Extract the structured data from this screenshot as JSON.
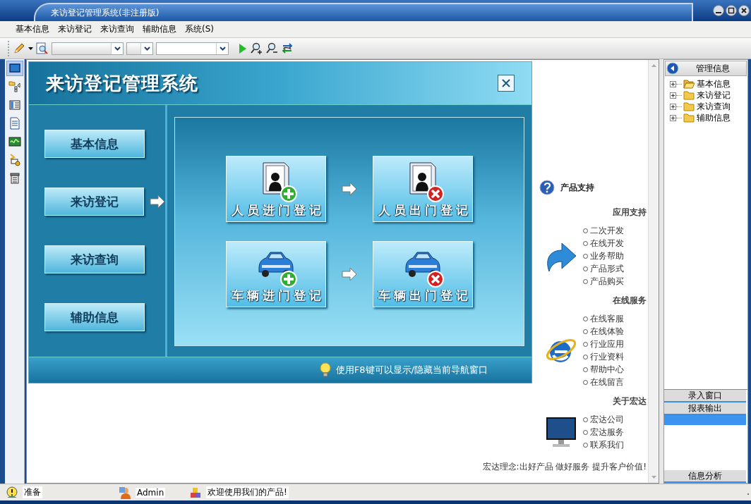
{
  "window": {
    "title": "来访登记管理系统(非注册版)"
  },
  "menu": [
    {
      "label": "基本信息"
    },
    {
      "label": "来访登记"
    },
    {
      "label": "来访查询"
    },
    {
      "label": "辅助信息"
    },
    {
      "label": "系统(S)"
    }
  ],
  "side_tools": [
    {
      "selected": true
    },
    {
      "selected": false
    },
    {
      "selected": false
    },
    {
      "selected": false
    },
    {
      "selected": false
    },
    {
      "selected": false
    },
    {
      "selected": false
    }
  ],
  "nav_panel": {
    "title": "来访登记管理系统",
    "nav_buttons": [
      {
        "label": "基本信息",
        "selected": false
      },
      {
        "label": "来访登记",
        "selected": true
      },
      {
        "label": "来访查询",
        "selected": false
      },
      {
        "label": "辅助信息",
        "selected": false
      }
    ],
    "tiles": [
      {
        "label": "人员进门登记",
        "kind": "person",
        "exit": false
      },
      {
        "label": "人员出门登记",
        "kind": "person",
        "exit": true
      },
      {
        "label": "车辆进门登记",
        "kind": "car",
        "exit": false
      },
      {
        "label": "车辆出门登记",
        "kind": "car",
        "exit": true
      }
    ],
    "tip": "使用F8键可以显示/隐藏当前导航窗口"
  },
  "support": {
    "title": "产品支持",
    "sections": [
      {
        "heading": "应用支持",
        "kind": "arrow",
        "links": [
          "二次开发",
          "在线开发",
          "业务帮助",
          "产品形式",
          "产品购买"
        ]
      },
      {
        "heading": "在线服务",
        "kind": "browser",
        "links": [
          "在线客服",
          "在线体验",
          "行业应用",
          "行业资料",
          "帮助中心",
          "在线留言"
        ]
      },
      {
        "heading": "关于宏达",
        "kind": "monitor",
        "links": [
          "宏达公司",
          "宏达服务",
          "联系我们"
        ]
      }
    ],
    "slogan": "宏达理念:出好产品 做好服务 提升客户价值!"
  },
  "tree": {
    "title": "管理信息",
    "items": [
      {
        "label": "基本信息",
        "selected": true
      },
      {
        "label": "来访登记",
        "selected": false
      },
      {
        "label": "来访查询",
        "selected": false
      },
      {
        "label": "辅助信息",
        "selected": false
      }
    ]
  },
  "outlook_bar": [
    {
      "label": "录入窗口",
      "expanded": false
    },
    {
      "label": "报表输出",
      "expanded": true
    },
    {
      "label": "信息分析",
      "expanded": false
    }
  ],
  "status_bar": [
    {
      "text": "准备",
      "kind": "ready"
    },
    {
      "text": "Admin",
      "kind": "user"
    },
    {
      "text": "欢迎使用我们的产品!",
      "kind": "message"
    }
  ]
}
